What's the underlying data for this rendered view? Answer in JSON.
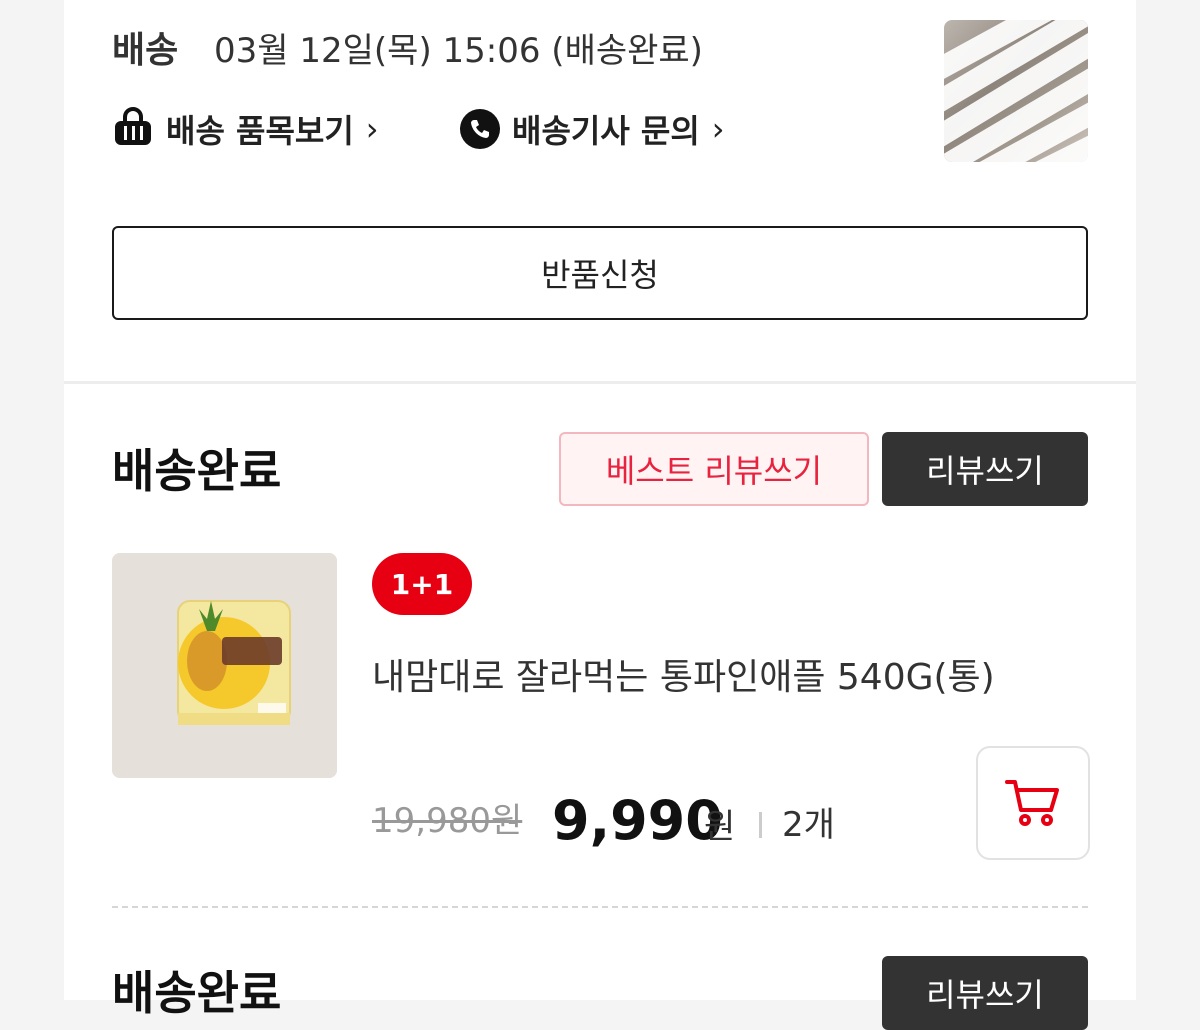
{
  "delivery": {
    "label": "배송",
    "datetime": "03월 12일(목) 15:06 (배송완료)",
    "items_link": "배송 품목보기",
    "driver_link": "배송기사 문의",
    "return_button": "반품신청"
  },
  "order_section": {
    "title": "배송완료",
    "best_review_button": "베스트 리뷰쓰기",
    "review_button": "리뷰쓰기",
    "product": {
      "badge": "1+1",
      "name": "내맘대로 잘라먹는 통파인애플 540G(통)",
      "original_price": "19,980원",
      "sale_price": "9,990",
      "currency": "원",
      "quantity": "2개"
    }
  },
  "next_section": {
    "title": "배송완료",
    "review_button": "리뷰쓰기"
  },
  "colors": {
    "accent_red": "#e60012",
    "best_review_bg": "#fff3f4",
    "dark_button": "#333333"
  },
  "icons": {
    "items": "shopping-bag-icon",
    "driver": "phone-icon",
    "cart": "cart-icon"
  }
}
